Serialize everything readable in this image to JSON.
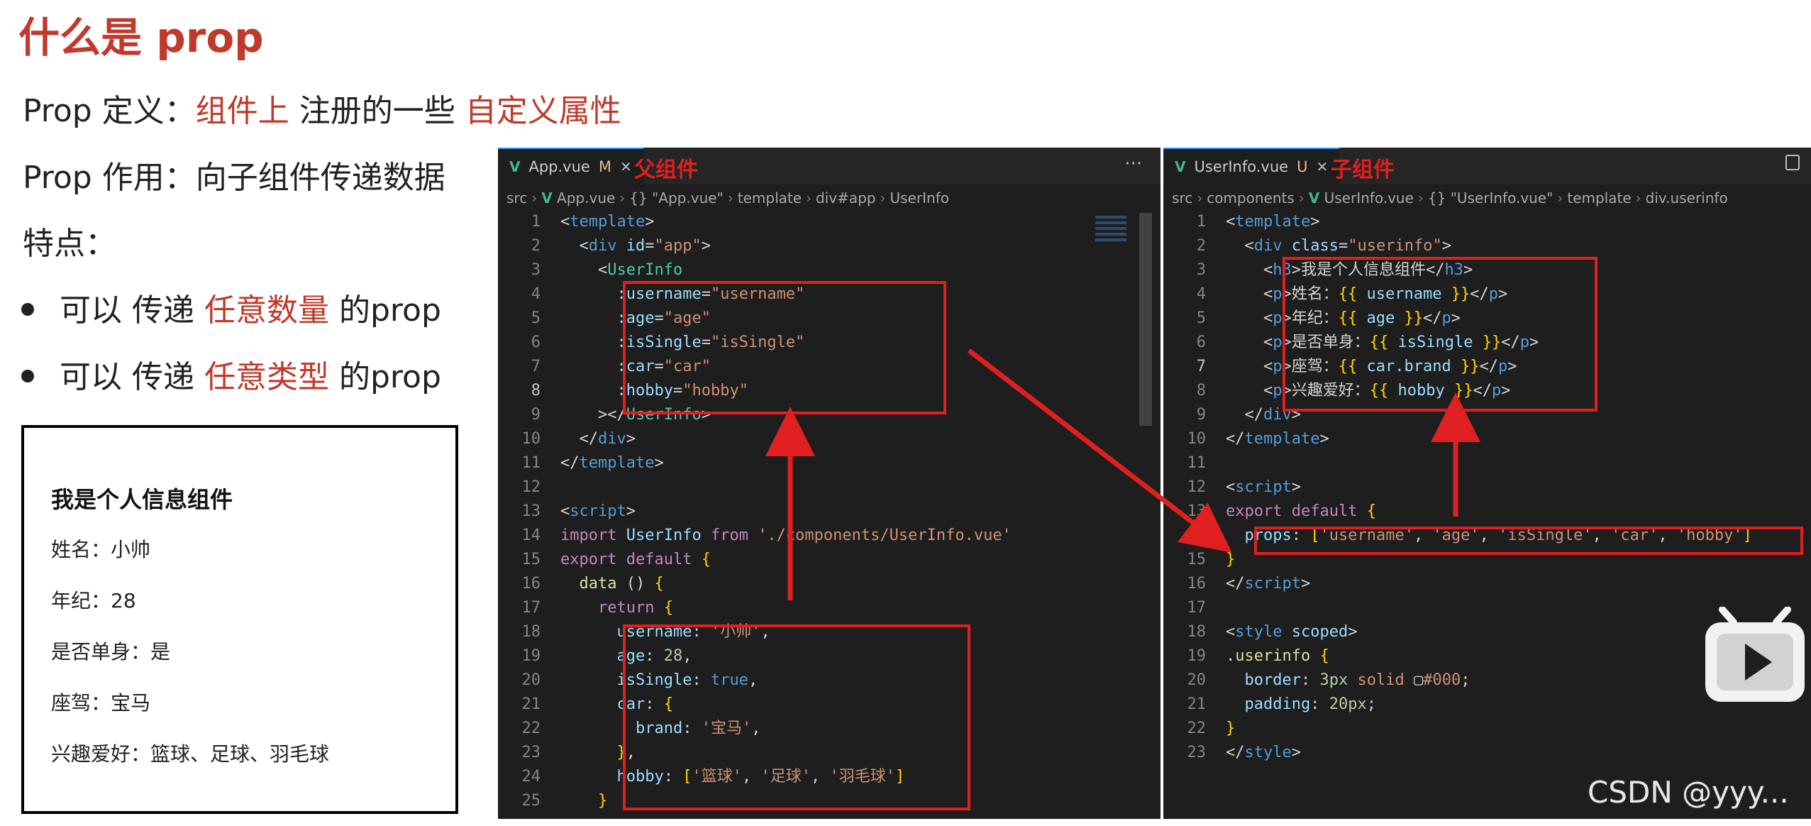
{
  "slide": {
    "title": "什么是 prop",
    "def_prefix": "Prop 定义：",
    "def_red1": "组件上",
    "def_mid": " 注册的一些 ",
    "def_red2": "自定义属性",
    "use_text": "Prop 作用：向子组件传递数据",
    "features": "特点：",
    "bullet1_pre": "可以 传递 ",
    "bullet1_red": "任意数量",
    "bullet1_post": " 的prop",
    "bullet2_pre": "可以 传递 ",
    "bullet2_red": "任意类型",
    "bullet2_post": " 的prop"
  },
  "preview": {
    "title": "我是个人信息组件",
    "lines": [
      "姓名：小帅",
      "年纪：28",
      "是否单身：是",
      "座驾：宝马",
      "兴趣爱好：篮球、足球、羽毛球"
    ]
  },
  "left_editor": {
    "tab_name": "App.vue",
    "tab_status": "M",
    "note": "父组件",
    "breadcrumb": [
      "src",
      "App.vue",
      "{} \"App.vue\"",
      "template",
      "div#app",
      "UserInfo"
    ],
    "more": "···"
  },
  "right_editor": {
    "tab_name": "UserInfo.vue",
    "tab_status": "U",
    "note": "子组件",
    "breadcrumb": [
      "src",
      "components",
      "UserInfo.vue",
      "{} \"UserInfo.vue\"",
      "template",
      "div.userinfo"
    ]
  },
  "watermark": "CSDN @yyy..."
}
